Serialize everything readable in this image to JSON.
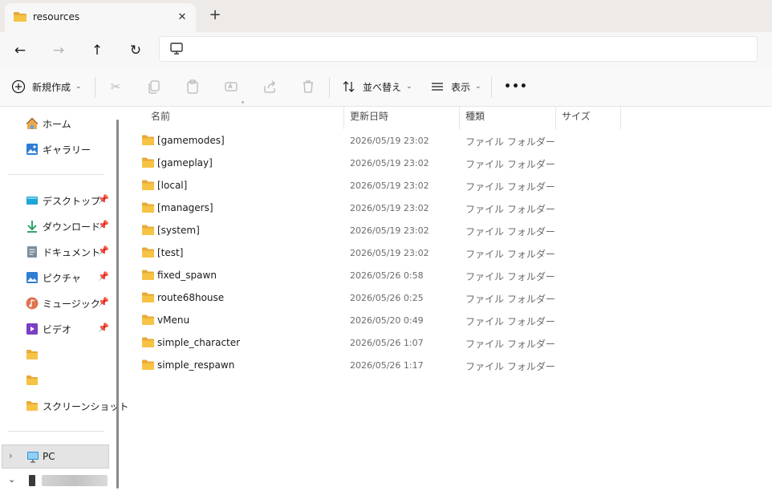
{
  "tab": {
    "title": "resources",
    "close_icon": "close-icon",
    "new_tab_icon": "plus-icon"
  },
  "nav": {
    "back": "←",
    "forward": "→",
    "up": "↑",
    "refresh": "↻"
  },
  "toolbar": {
    "new_label": "新規作成",
    "sort_label": "並べ替え",
    "view_label": "表示",
    "more_label": "•••"
  },
  "sidebar": {
    "home": "ホーム",
    "gallery": "ギャラリー",
    "pinned": [
      {
        "label": "デスクトップ",
        "icon": "desktop-icon"
      },
      {
        "label": "ダウンロード",
        "icon": "download-icon"
      },
      {
        "label": "ドキュメント",
        "icon": "document-icon"
      },
      {
        "label": "ピクチャ",
        "icon": "picture-icon"
      },
      {
        "label": "ミュージック",
        "icon": "music-icon"
      },
      {
        "label": "ビデオ",
        "icon": "video-icon"
      }
    ],
    "folders": [
      {
        "label": "",
        "icon": "folder-icon"
      },
      {
        "label": "",
        "icon": "folder-icon"
      },
      {
        "label": "スクリーンショット",
        "icon": "folder-icon"
      }
    ],
    "pc": "PC"
  },
  "columns": {
    "name": "名前",
    "date": "更新日時",
    "type": "種類",
    "size": "サイズ"
  },
  "files": [
    {
      "name": "[gamemodes]",
      "date": "2026/05/19 23:02",
      "type": "ファイル フォルダー"
    },
    {
      "name": "[gameplay]",
      "date": "2026/05/19 23:02",
      "type": "ファイル フォルダー"
    },
    {
      "name": "[local]",
      "date": "2026/05/19 23:02",
      "type": "ファイル フォルダー"
    },
    {
      "name": "[managers]",
      "date": "2026/05/19 23:02",
      "type": "ファイル フォルダー"
    },
    {
      "name": "[system]",
      "date": "2026/05/19 23:02",
      "type": "ファイル フォルダー"
    },
    {
      "name": "[test]",
      "date": "2026/05/19 23:02",
      "type": "ファイル フォルダー"
    },
    {
      "name": "fixed_spawn",
      "date": "2026/05/26 0:58",
      "type": "ファイル フォルダー"
    },
    {
      "name": "route68house",
      "date": "2026/05/26 0:25",
      "type": "ファイル フォルダー"
    },
    {
      "name": "vMenu",
      "date": "2026/05/20 0:49",
      "type": "ファイル フォルダー"
    },
    {
      "name": "simple_character",
      "date": "2026/05/26 1:07",
      "type": "ファイル フォルダー"
    },
    {
      "name": "simple_respawn",
      "date": "2026/05/26 1:17",
      "type": "ファイル フォルダー"
    }
  ],
  "colors": {
    "folder": "#f6c344",
    "folder_dark": "#e8a93a",
    "accent": "#0067c0"
  }
}
